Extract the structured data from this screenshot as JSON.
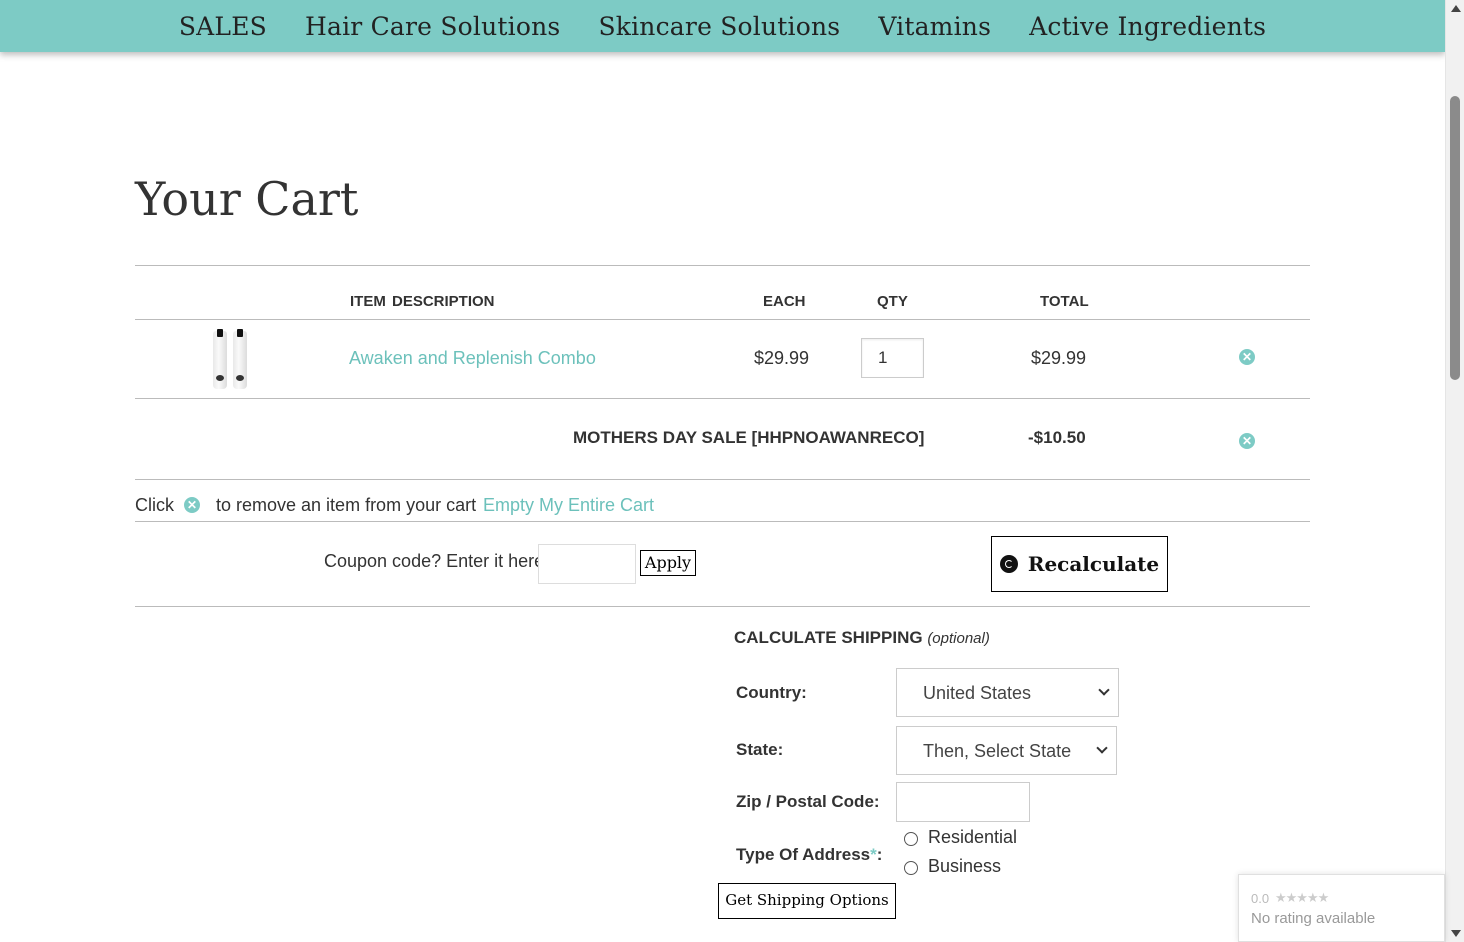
{
  "nav": {
    "items": [
      "SALES",
      "Hair Care Solutions",
      "Skincare Solutions",
      "Vitamins",
      "Active Ingredients"
    ]
  },
  "page": {
    "title": "Your Cart"
  },
  "cart": {
    "headers": {
      "description": "ITEM  DESCRIPTION",
      "each": "EACH",
      "qty": "QTY",
      "total": "TOTAL"
    },
    "items": [
      {
        "name": "Awaken and Replenish Combo",
        "each": "$29.99",
        "qty": "1",
        "total": "$29.99"
      }
    ],
    "discount": {
      "label": "MOTHERS DAY SALE [HHPNOAWANRECO]",
      "amount": "-$10.50"
    },
    "remove_hint": {
      "before": "Click",
      "after": "to remove an item from your cart"
    },
    "empty_cart_label": "Empty My Entire Cart"
  },
  "coupon": {
    "label": "Coupon code? Enter it here:",
    "value": "",
    "apply_label": "Apply"
  },
  "recalculate_label": "Recalculate",
  "shipping": {
    "heading": "CALCULATE SHIPPING",
    "heading_note": "(optional)",
    "country_label": "Country:",
    "country_value": "United States",
    "state_label": "State:",
    "state_value": "Then, Select State",
    "zip_label": "Zip / Postal Code:",
    "zip_value": "",
    "address_type_label": "Type Of Address",
    "address_type_required": "*",
    "address_type_colon": ":",
    "options": [
      "Residential",
      "Business"
    ],
    "button_label": "Get Shipping Options"
  },
  "rating_widget": {
    "score": "0.0",
    "stars": "★★★★★",
    "text": "No rating available"
  },
  "colors": {
    "accent": "#7dcbc5",
    "link": "#6cc1bb"
  }
}
